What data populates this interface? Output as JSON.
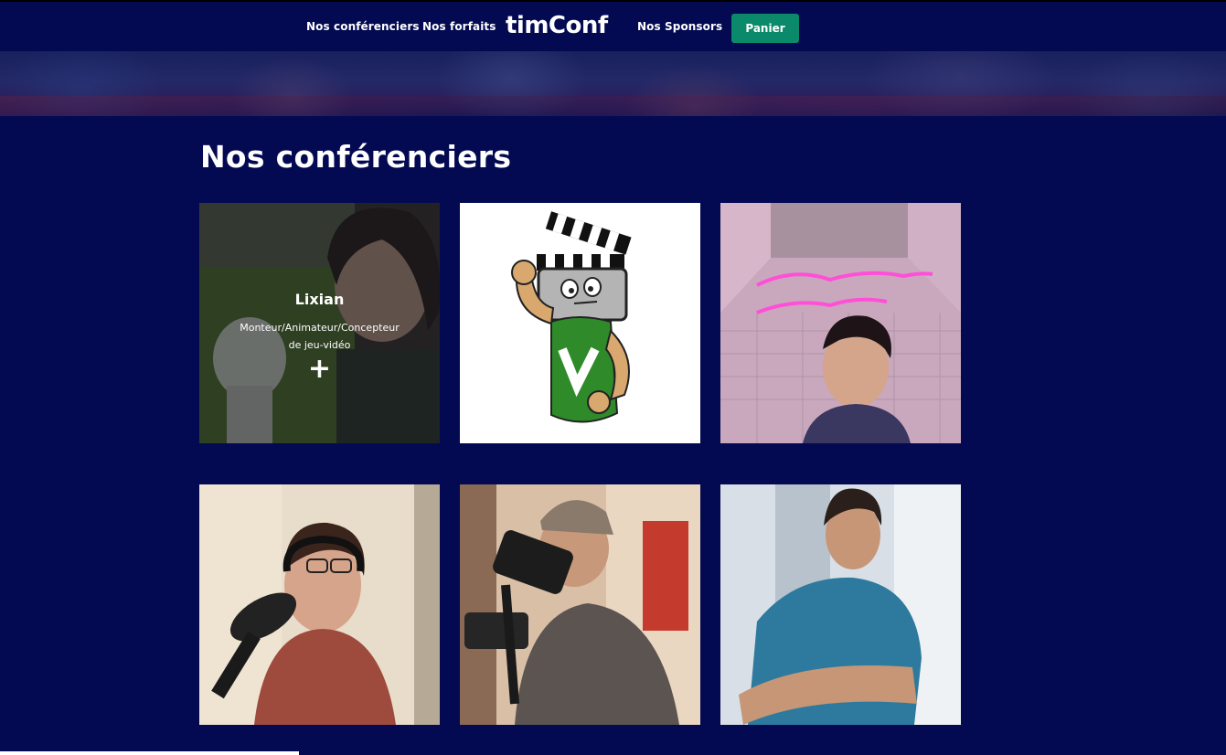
{
  "nav": {
    "speakers_link": "Nos conférenciers",
    "plans_link": "Nos forfaits",
    "brand": "timConf",
    "sponsors_link": "Nos Sponsors",
    "cart_button": "Panier"
  },
  "main": {
    "section_title": "Nos conférenciers",
    "speakers": [
      {
        "name": "Lixian",
        "role": "Monteur/Animateur/Concepteur de jeu-vidéo",
        "more_icon": "+"
      }
    ]
  },
  "colors": {
    "background": "#030a52",
    "cart_button": "#0a8a6b",
    "text": "#ffffff"
  },
  "icons": {
    "more": "plus-icon"
  }
}
